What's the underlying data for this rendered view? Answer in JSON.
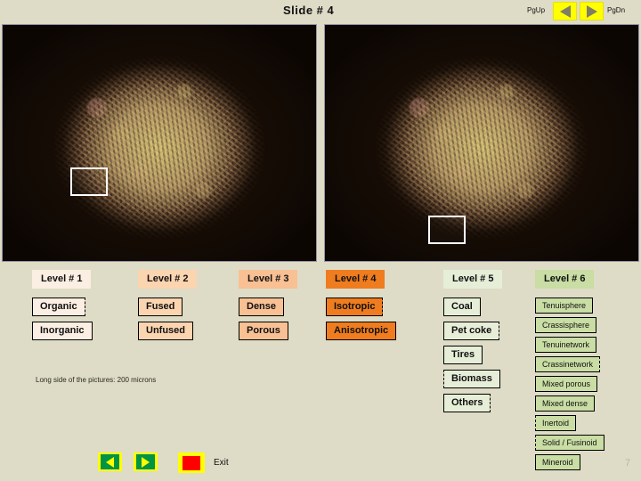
{
  "header": {
    "title": "Slide # 4",
    "pgup_label": "PgUp",
    "pgdn_label": "PgDn"
  },
  "images": {
    "left_alt": "coal petrography micrograph left",
    "right_alt": "coal petrography micrograph right"
  },
  "caption": "Long side of the pictures: 200 microns",
  "columns": [
    {
      "header": "Level # 1",
      "items": [
        {
          "label": "Organic",
          "selected": true
        },
        {
          "label": "Inorganic",
          "selected": false
        }
      ]
    },
    {
      "header": "Level # 2",
      "items": [
        {
          "label": "Fused",
          "selected": false
        },
        {
          "label": "Unfused",
          "selected": false
        }
      ]
    },
    {
      "header": "Level # 3",
      "items": [
        {
          "label": "Dense",
          "selected": false
        },
        {
          "label": "Porous",
          "selected": false
        }
      ]
    },
    {
      "header": "Level # 4",
      "items": [
        {
          "label": "Isotropic",
          "selected": true
        },
        {
          "label": "Anisotropic",
          "selected": false
        }
      ]
    },
    {
      "header": "Level # 5",
      "items": [
        {
          "label": "Coal",
          "selected": false
        },
        {
          "label": "Pet coke",
          "selected": true
        },
        {
          "label": "Tires",
          "selected": false
        },
        {
          "label": "Biomass",
          "selected": true
        },
        {
          "label": "Others",
          "selected": true
        }
      ]
    },
    {
      "header": "Level # 6",
      "items": [
        {
          "label": "Tenuisphere",
          "selected": false
        },
        {
          "label": "Crassisphere",
          "selected": false
        },
        {
          "label": "Tenuinetwork",
          "selected": false
        },
        {
          "label": "Crassinetwork",
          "selected": true
        },
        {
          "label": "Mixed porous",
          "selected": false
        },
        {
          "label": "Mixed dense",
          "selected": false
        },
        {
          "label": "Inertoid",
          "selected": true
        },
        {
          "label": "Solid / Fusinoid",
          "selected": true
        },
        {
          "label": "Mineroid",
          "selected": false
        }
      ]
    }
  ],
  "footer": {
    "exit_label": "Exit",
    "page_number": "7"
  },
  "colors": {
    "background": "#dedcc6",
    "accent_yellow": "#ffff00",
    "level4_orange": "#ef7c1e",
    "level6_green": "#c9dda4",
    "stop_red": "#ff0000",
    "nav_green": "#009444"
  }
}
